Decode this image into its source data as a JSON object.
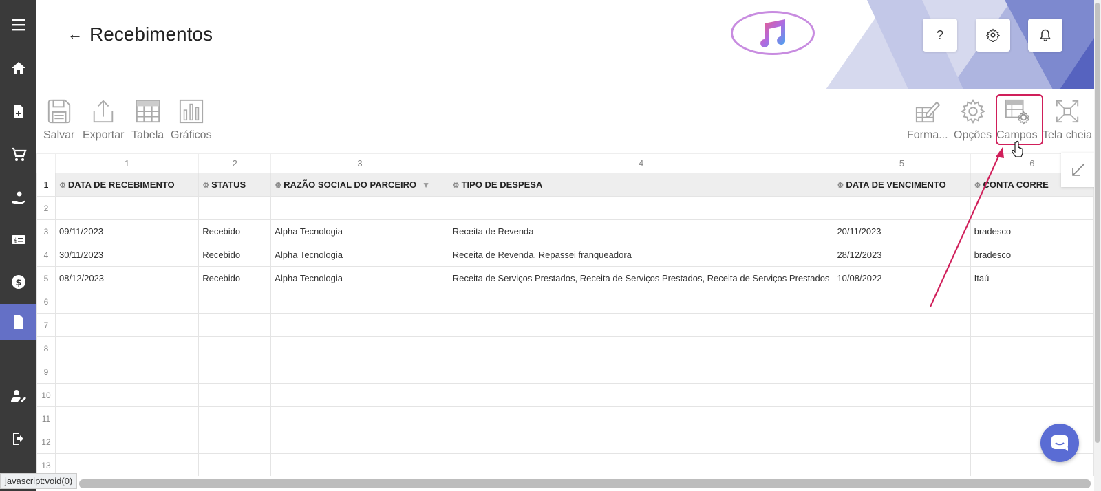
{
  "header": {
    "title": "Recebimentos",
    "back_icon": "←",
    "help_label": "?"
  },
  "toolbar_left": [
    {
      "label": "Salvar",
      "icon": "save-icon"
    },
    {
      "label": "Exportar",
      "icon": "export-icon"
    },
    {
      "label": "Tabela",
      "icon": "table-icon"
    },
    {
      "label": "Gráficos",
      "icon": "charts-icon"
    }
  ],
  "toolbar_right": [
    {
      "label": "Forma...",
      "icon": "format-icon"
    },
    {
      "label": "Opções",
      "icon": "options-gear-icon"
    },
    {
      "label": "Campos",
      "icon": "fields-icon"
    },
    {
      "label": "Tela cheia",
      "icon": "fullscreen-icon"
    }
  ],
  "grid": {
    "col_numbers": [
      "1",
      "2",
      "3",
      "4",
      "5",
      "6"
    ],
    "headers": [
      "DATA DE RECEBIMENTO",
      "STATUS",
      "RAZÃO SOCIAL DO PARCEIRO",
      "TIPO DE DESPESA",
      "DATA DE VENCIMENTO",
      "CONTA CORRE"
    ],
    "row_numbers": [
      "1",
      "2",
      "3",
      "4",
      "5",
      "6",
      "7",
      "8",
      "9",
      "10",
      "11",
      "12",
      "13"
    ],
    "rows": [
      [
        "",
        "",
        "",
        "",
        "",
        ""
      ],
      [
        "09/11/2023",
        "Recebido",
        "Alpha Tecnologia",
        "Receita de Revenda",
        "20/11/2023",
        "bradesco"
      ],
      [
        "30/11/2023",
        "Recebido",
        "Alpha Tecnologia",
        "Receita de Revenda, Repassei franqueadora",
        "28/12/2023",
        "bradesco"
      ],
      [
        "08/12/2023",
        "Recebido",
        "Alpha Tecnologia",
        "Receita de Serviços Prestados, Receita de Serviços Prestados, Receita de Serviços Prestados",
        "10/08/2022",
        "Itaú"
      ],
      [
        "",
        "",
        "",
        "",
        "",
        ""
      ],
      [
        "",
        "",
        "",
        "",
        "",
        ""
      ],
      [
        "",
        "",
        "",
        "",
        "",
        ""
      ],
      [
        "",
        "",
        "",
        "",
        "",
        ""
      ],
      [
        "",
        "",
        "",
        "",
        "",
        ""
      ],
      [
        "",
        "",
        "",
        "",
        "",
        ""
      ],
      [
        "",
        "",
        "",
        "",
        "",
        ""
      ],
      [
        "",
        "",
        "",
        "",
        "",
        ""
      ]
    ]
  },
  "status_bar": "javascript:void(0)",
  "colors": {
    "sidebar": "#3a3a3a",
    "active": "#6470c6",
    "highlight": "#d01f5a",
    "chat": "#5a6cd4"
  }
}
